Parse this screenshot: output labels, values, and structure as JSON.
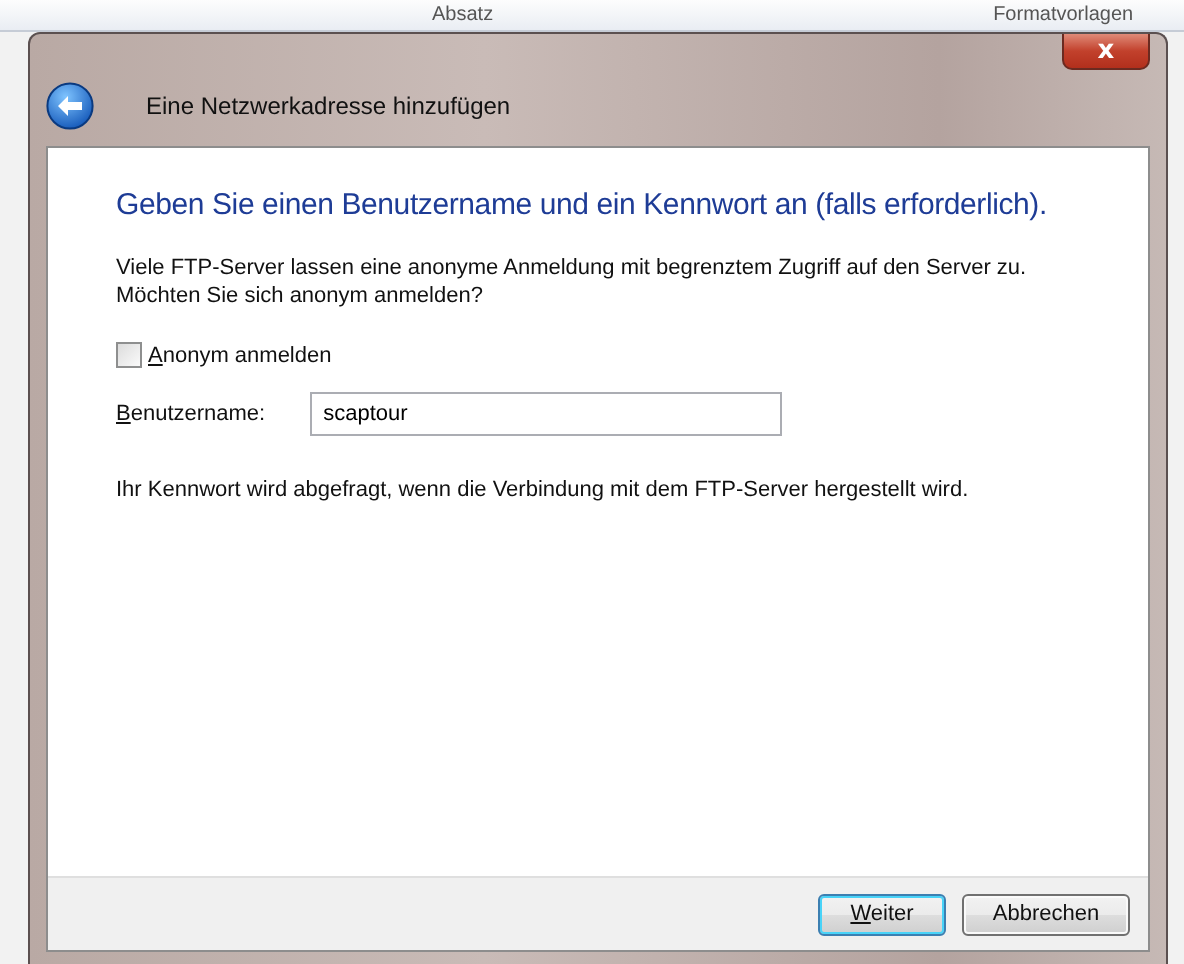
{
  "background_ribbon": [
    "Absatz",
    "Formatvorlagen"
  ],
  "window": {
    "title": "Eine Netzwerkadresse hinzufügen",
    "close": "x"
  },
  "heading": "Geben Sie einen Benutzername und ein Kennwort an (falls erforderlich).",
  "intro": "Viele FTP-Server lassen eine anonyme Anmeldung mit begrenztem Zugriff auf den Server zu. Möchten Sie sich anonym anmelden?",
  "anonymous": {
    "label": "Anonym anmelden",
    "checked": false
  },
  "username": {
    "label": "Benutzername:",
    "value": "scaptour"
  },
  "note": "Ihr Kennwort wird abgefragt, wenn die Verbindung mit dem FTP-Server hergestellt wird.",
  "buttons": [
    {
      "label": "Weiter",
      "default": true
    },
    {
      "label": "Abbrechen",
      "default": false
    }
  ]
}
